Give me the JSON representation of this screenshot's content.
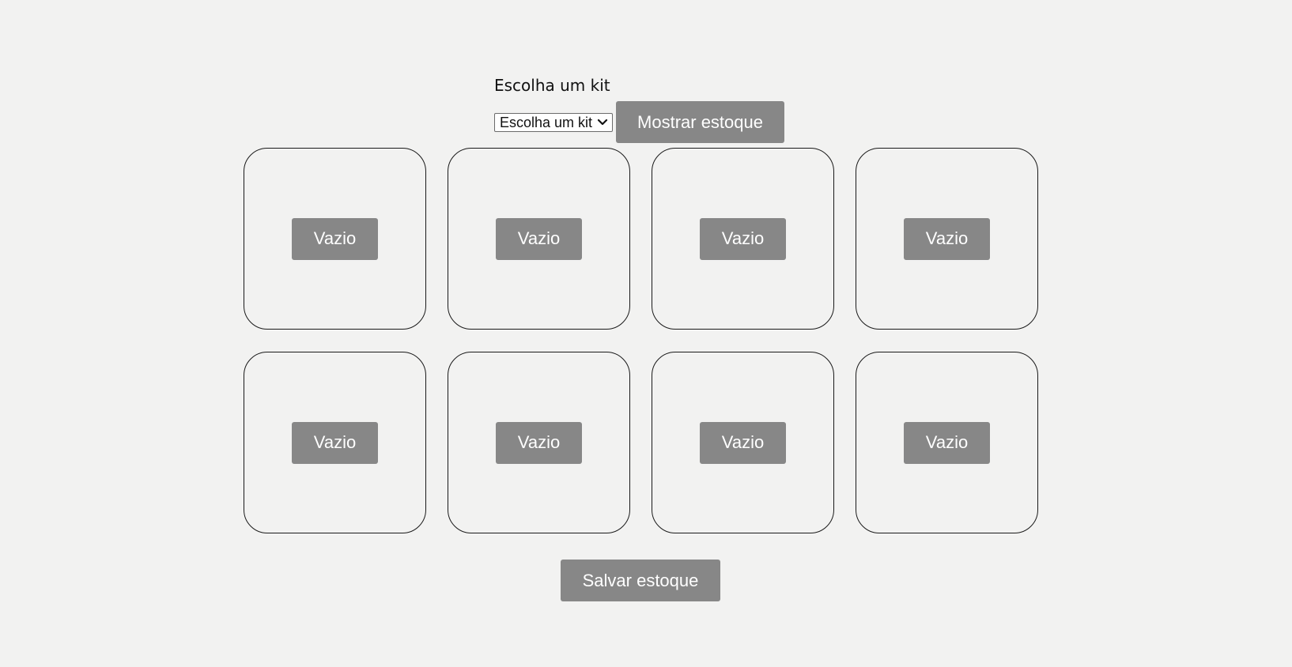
{
  "kit_section": {
    "heading": "Escolha um kit",
    "select_value": "Escolha um kit",
    "show_stock_label": "Mostrar estoque"
  },
  "slots": [
    {
      "label": "Vazio"
    },
    {
      "label": "Vazio"
    },
    {
      "label": "Vazio"
    },
    {
      "label": "Vazio"
    },
    {
      "label": "Vazio"
    },
    {
      "label": "Vazio"
    },
    {
      "label": "Vazio"
    },
    {
      "label": "Vazio"
    }
  ],
  "save_stock_label": "Salvar estoque",
  "colors": {
    "background": "#f2f2f1",
    "button": "#878787",
    "button_text": "#ffffff",
    "border": "#1a1a1a"
  },
  "icons": {
    "select_arrow": "chevron-down-icon"
  }
}
